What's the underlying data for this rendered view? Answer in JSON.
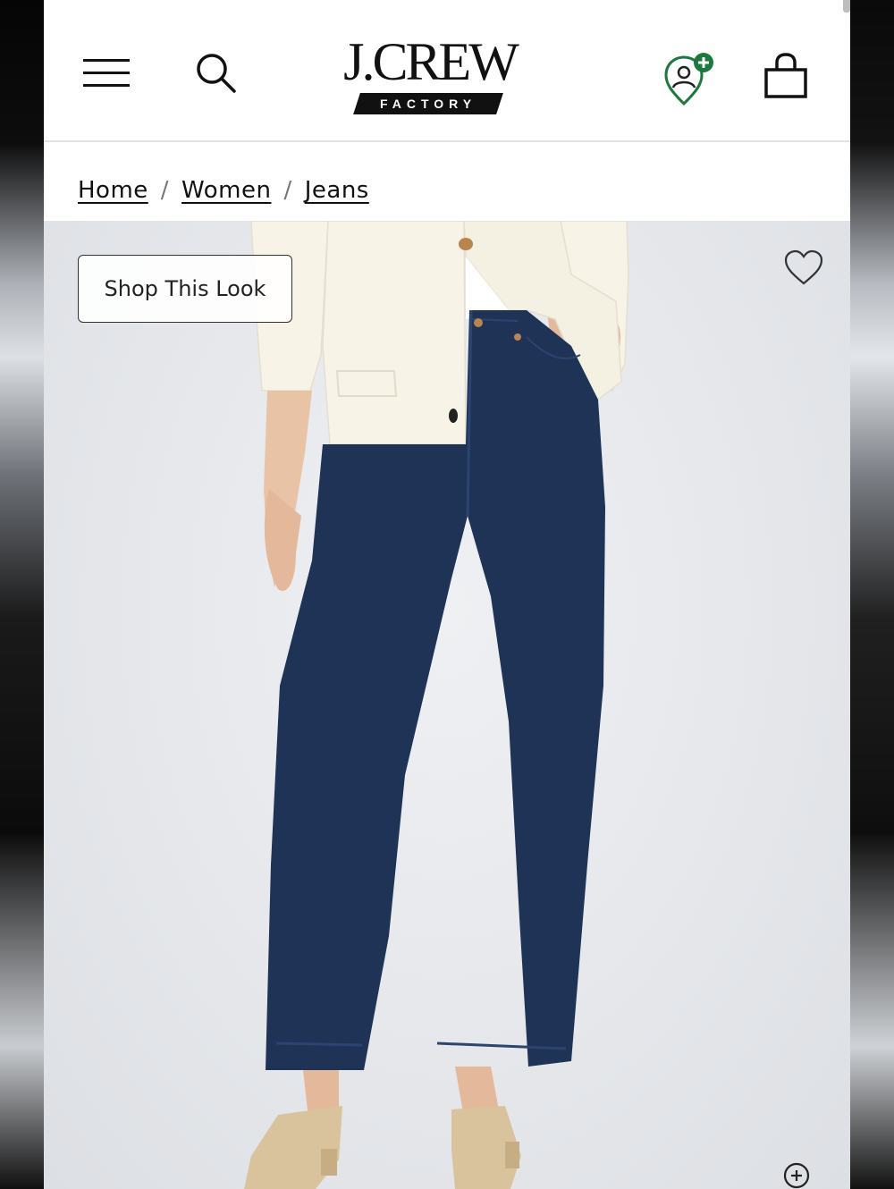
{
  "header": {
    "menu_icon": "hamburger-menu-icon",
    "search_icon": "search-icon",
    "logo": {
      "brand": "J.CREW",
      "sub": "FACTORY"
    },
    "rewards_icon": "rewards-badge-icon",
    "bag_icon": "shopping-bag-icon"
  },
  "breadcrumb": {
    "items": [
      "Home",
      "Women",
      "Jeans"
    ],
    "separator": "/"
  },
  "product_image": {
    "shop_look_label": "Shop This Look",
    "favorite_icon": "heart-icon",
    "zoom_icon": "zoom-in-icon"
  },
  "colors": {
    "rewards_green": "#1a7a3e",
    "denim": "#1f3356",
    "cardigan": "#f7f3e6"
  }
}
